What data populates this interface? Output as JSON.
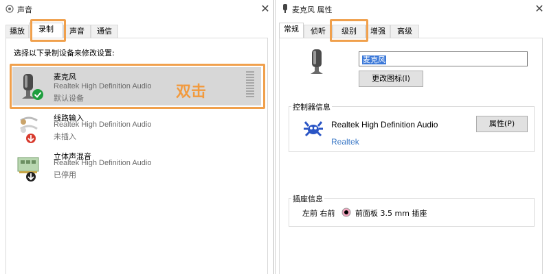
{
  "left_window": {
    "title": "声音",
    "close": "✕",
    "tabs": [
      "播放",
      "录制",
      "声音",
      "通信"
    ],
    "instruction": "选择以下录制设备来修改设置:",
    "devices": [
      {
        "name": "麦克风",
        "driver": "Realtek High Definition Audio",
        "status": "默认设备",
        "selected": true
      },
      {
        "name": "线路输入",
        "driver": "Realtek High Definition Audio",
        "status": "未插入",
        "selected": false
      },
      {
        "name": "立体声混音",
        "driver": "Realtek High Definition Audio",
        "status": "已停用",
        "selected": false
      }
    ],
    "annotation": "双击"
  },
  "right_window": {
    "title": "麦克风 属性",
    "close": "✕",
    "tabs": [
      "常规",
      "侦听",
      "级别",
      "增强",
      "高级"
    ],
    "device_name_value": "麦克风",
    "change_icon_button": "更改图标(I)",
    "controller_group_label": "控制器信息",
    "controller_name": "Realtek High Definition Audio",
    "controller_vendor_link": "Realtek",
    "properties_button": "属性(P)",
    "jack_group_label": "插座信息",
    "jack_location": "左前 右前",
    "jack_description": "前面板 3.5 mm 插座"
  },
  "colors": {
    "highlight": "#f0a04c",
    "annotation_text": "#f29a3d",
    "selected_row": "#d7d7d7",
    "link": "#3b78c6",
    "default_badge": "#1e9e3e",
    "disabled_badge": "#d83b2e"
  }
}
